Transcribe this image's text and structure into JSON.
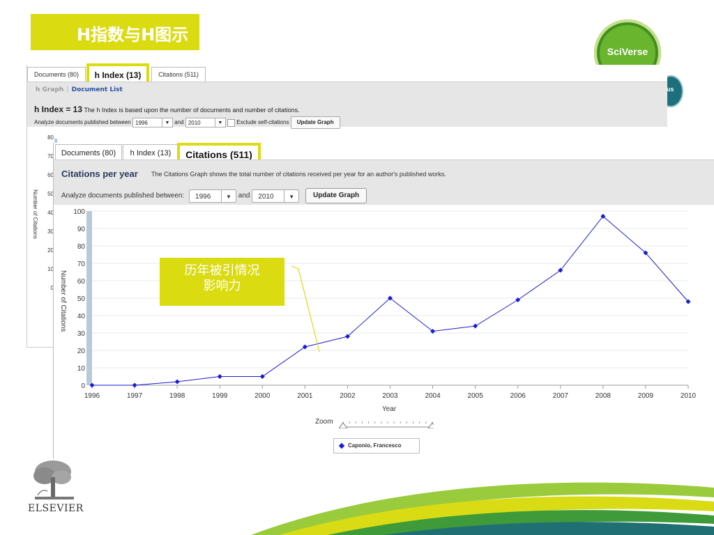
{
  "slide": {
    "title": "H指数与H图示",
    "callout_line1": "历年被引情况",
    "callout_line2": "影响力",
    "sciverse_logo": "SciVerse",
    "scopus_logo_fragment": "us",
    "elsevier_logo": "ELSEVIER"
  },
  "back_panel": {
    "tabs": [
      "Documents (80)",
      "h Index (13)",
      "Citations (511)"
    ],
    "subnav": {
      "graph": "h Graph",
      "sep": "|",
      "list": "Document List"
    },
    "h_value": "h Index = 13",
    "h_desc": "The h Index is based upon the number of documents and number of citations.",
    "analyze_label": "Analyze documents published between",
    "from_year": "1996",
    "and_label": "and",
    "to_year": "2010",
    "exclude_label": "Exclude self-citations",
    "update_label": "Update Graph",
    "y_ticks": [
      "80",
      "70",
      "60",
      "50",
      "40",
      "30",
      "20",
      "10",
      "0"
    ],
    "y_label": "Number of Citations"
  },
  "front_panel": {
    "tabs": [
      "Documents (80)",
      "h Index (13)",
      "Citations (511)"
    ],
    "title": "Citations per year",
    "description": "The Citations Graph shows the total number of citations received per year for an author's published works.",
    "analyze_label": "Analyze documents published between:",
    "from_year": "1996",
    "and_label": "and",
    "to_year": "2010",
    "update_label": "Update Graph",
    "zoom_label": "Zoom",
    "legend_author": "Caponio, Francesco"
  },
  "chart_data": {
    "type": "line",
    "xlabel": "Year",
    "ylabel": "Number of Citations",
    "x": [
      1996,
      1997,
      1998,
      1999,
      2000,
      2001,
      2002,
      2003,
      2004,
      2005,
      2006,
      2007,
      2008,
      2009,
      2010
    ],
    "ylim": [
      0,
      100
    ],
    "yticks": [
      0,
      10,
      20,
      30,
      40,
      50,
      60,
      70,
      80,
      90,
      100
    ],
    "series": [
      {
        "name": "Caponio, Francesco",
        "values": [
          0,
          0,
          2,
          5,
          5,
          22,
          28,
          50,
          31,
          34,
          49,
          66,
          97,
          76,
          48
        ]
      }
    ],
    "line_color": "#1a1ad4",
    "grid": true
  },
  "colors": {
    "accent": "#dbdb12",
    "series": "#1a1ad4",
    "panel_bar": "#e6e6e6"
  }
}
